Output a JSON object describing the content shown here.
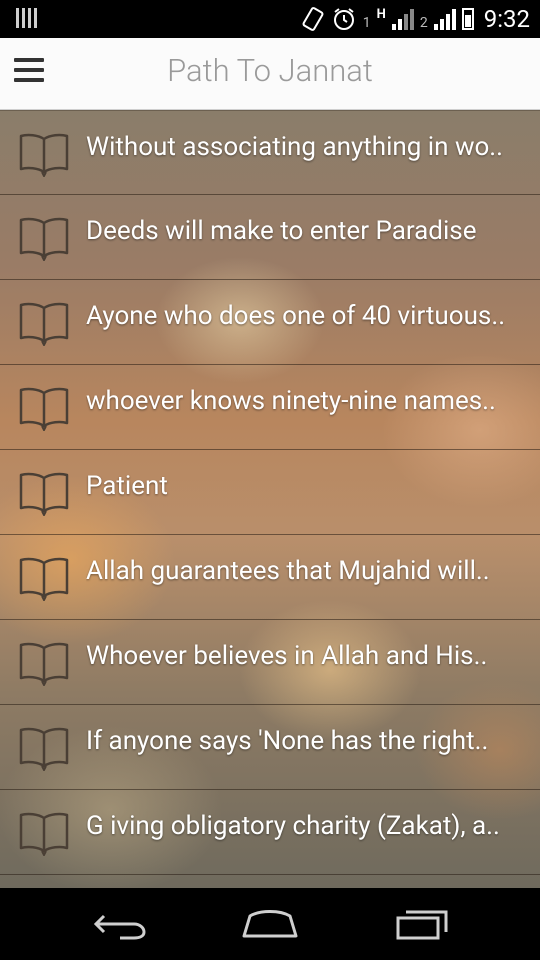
{
  "status_bar": {
    "time": "9:32",
    "sim1_label": "1",
    "sim2_label": "2",
    "network_label": "H"
  },
  "app_bar": {
    "title": "Path To Jannat"
  },
  "items": [
    {
      "label": "Without associating anything in wo.."
    },
    {
      "label": "Deeds will make to enter Paradise"
    },
    {
      "label": "Ayone who does one of 40 virtuous.."
    },
    {
      "label": "whoever knows ninety-nine names.."
    },
    {
      "label": "Patient"
    },
    {
      "label": " Allah guarantees that Mujahid will.."
    },
    {
      "label": "Whoever believes in Allah and His.."
    },
    {
      "label": " If anyone says 'None has the right.."
    },
    {
      "label": "G iving obligatory charity (Zakat), a.."
    }
  ]
}
